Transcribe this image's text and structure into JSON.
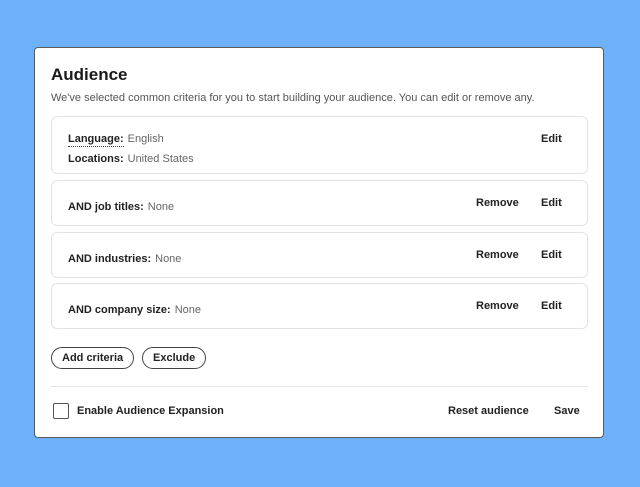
{
  "panel": {
    "title": "Audience",
    "subtitle": "We've selected common criteria for you to start building your audience. You can edit or remove any."
  },
  "criteria": {
    "language_label": "Language:",
    "language_value": "English",
    "locations_label": "Locations:",
    "locations_value": "United States",
    "job_titles_label": "AND job titles:",
    "job_titles_value": "None",
    "industries_label": "AND industries:",
    "industries_value": "None",
    "company_size_label": "AND company size:",
    "company_size_value": "None"
  },
  "actions": {
    "edit": "Edit",
    "remove": "Remove",
    "add_criteria": "Add criteria",
    "exclude": "Exclude"
  },
  "footer": {
    "expansion_label": "Enable Audience Expansion",
    "expansion_checked": false,
    "reset": "Reset audience",
    "save": "Save"
  }
}
